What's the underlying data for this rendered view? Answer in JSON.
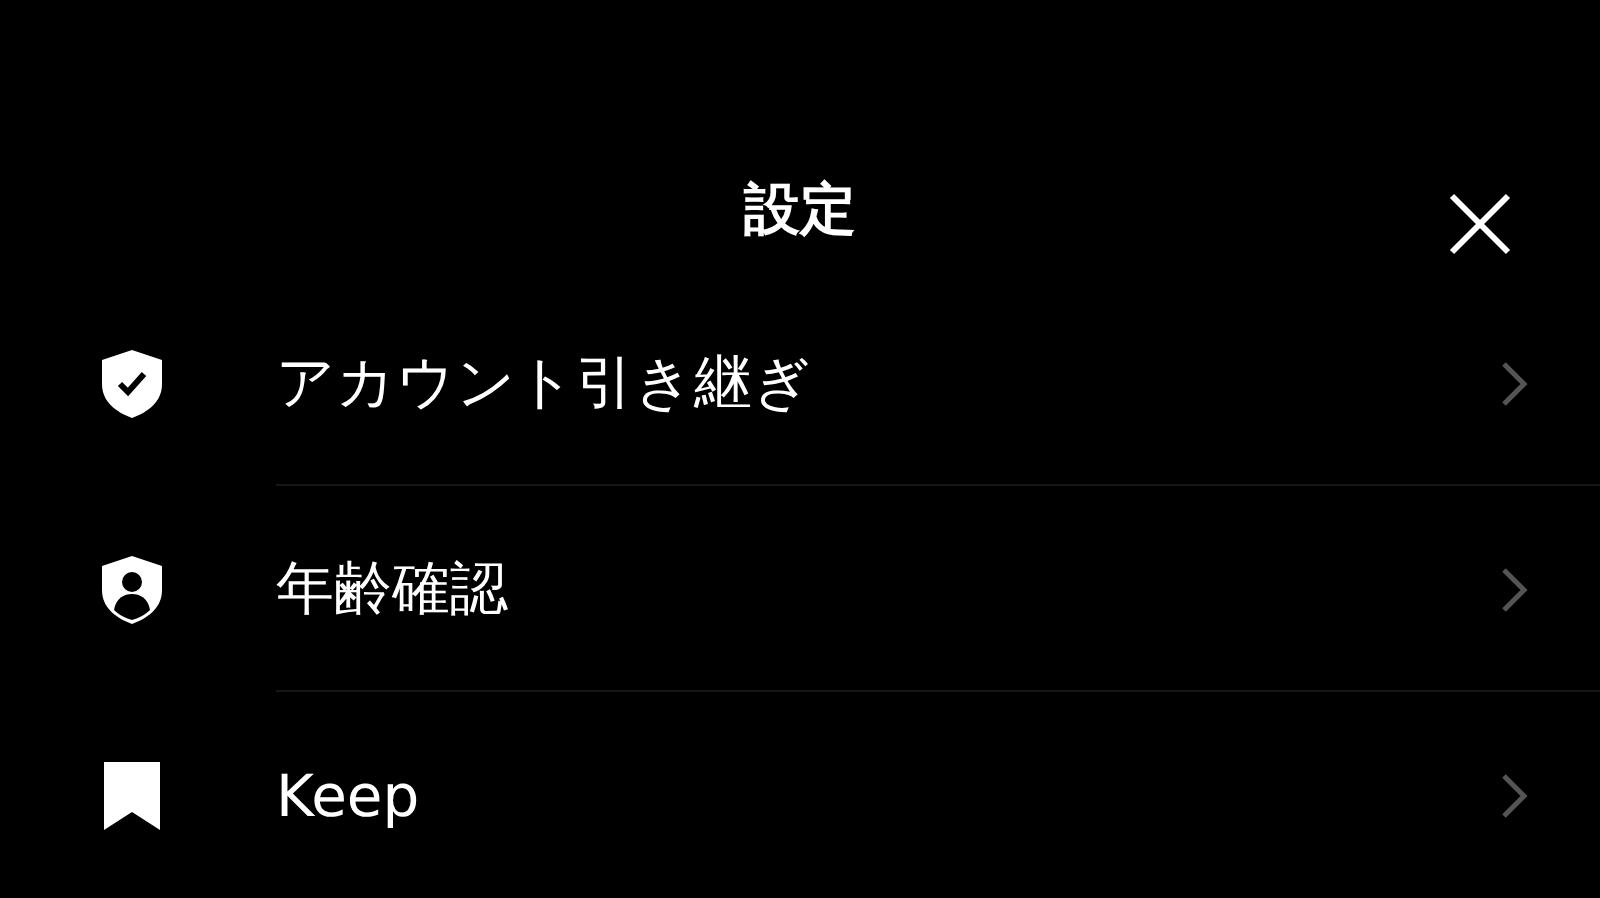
{
  "header": {
    "title": "設定"
  },
  "items": [
    {
      "label": "アカウント引き継ぎ",
      "kind": "shield-check"
    },
    {
      "label": "年齢確認",
      "kind": "shield-person"
    },
    {
      "label": "Keep",
      "kind": "bookmark"
    }
  ]
}
